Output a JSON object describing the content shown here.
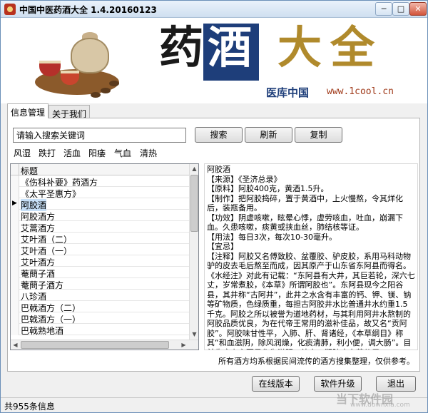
{
  "window": {
    "title": "中国中医药酒大全 1.4.20160123",
    "min_glyph": "─",
    "max_glyph": "□",
    "close_glyph": "✕"
  },
  "banner": {
    "chars": [
      "药",
      "酒",
      "大",
      "全"
    ],
    "subtitle_cn": "医库中国",
    "subtitle_url": "www.1cool.cn"
  },
  "tabs": [
    {
      "label": "信息管理"
    },
    {
      "label": "关于我们"
    }
  ],
  "search": {
    "value": "请输入搜索关键词"
  },
  "buttons": {
    "search": "搜索",
    "refresh": "刷新",
    "copy": "复制",
    "online": "在线版本",
    "upgrade": "软件升级",
    "exit": "退出"
  },
  "categories": [
    "风湿",
    "跌打",
    "活血",
    "阳痿",
    "气血",
    "清热"
  ],
  "list": {
    "header": "标题",
    "items": [
      "《伤科补要》药酒方",
      "《太平圣惠方》",
      "阿胶酒",
      "阿胶酒方",
      "艾蒿酒方",
      "艾叶酒（二）",
      "艾叶酒（一）",
      "艾叶酒方",
      "菴蔄子酒",
      "菴蔄子酒方",
      "八珍酒",
      "巴戟酒方（二）",
      "巴戟酒方（一）",
      "巴戟熟地酒"
    ],
    "selected_index": 2,
    "selected_marker": "▶"
  },
  "detail": {
    "text": "阿胶酒\n【来源】《圣济总录》\n【原料】阿胶400克，黄酒1.5升。\n【制作】把阿胶捣碎，置于黄酒中，上火慢熬，令其烊化后，装瓶备用。\n【功效】阴虚咳嗽，眩晕心悸，虚劳咳血，吐血，崩漏下血。久患咳嗽，痰黄或挟血丝，肺结核等证。\n【用法】每日3次，每次10-30毫升。\n【宜忌】\n【注释】阿胶又名傅致胶、盆覆胶、驴皮胶，系用马科动物驴的皮去毛后熬至而成，因其原产于山东省东阿县而得名。《水经注》对此有记载：“东阿县有大井，其巨若轮，深六七丈，岁常煮胶，《本草》所谓阿胶也”。东阿县现今之阳谷县，其井称“古阿井”，此井之水含有丰富的钙、钾、镁、钠等矿物质，色绿质重，每担古阿胶井水比普通井水约重1.5千克。阿胶之所以被誉为道地药材，与其利用阿井水熬制的阿胶品质优良，为在代帝王常用的滋补佳品，故又名“贡阿胶”。阿胶味甘性平，入肺、肝、肾诸经，《本草纲目》称其“和血滋阴，除风润燥，化痰清肺，利小便，调大肠”。目前临床上主要是作为滋阴、补血、润肺止血药使用。"
  },
  "footnote": "所有酒方均系根据民间流传的酒方搜集整理，仅供参考。",
  "status": {
    "text": "共955条信息"
  },
  "watermark": {
    "line1": "当下软件园",
    "line2": "www.downxia.com"
  }
}
